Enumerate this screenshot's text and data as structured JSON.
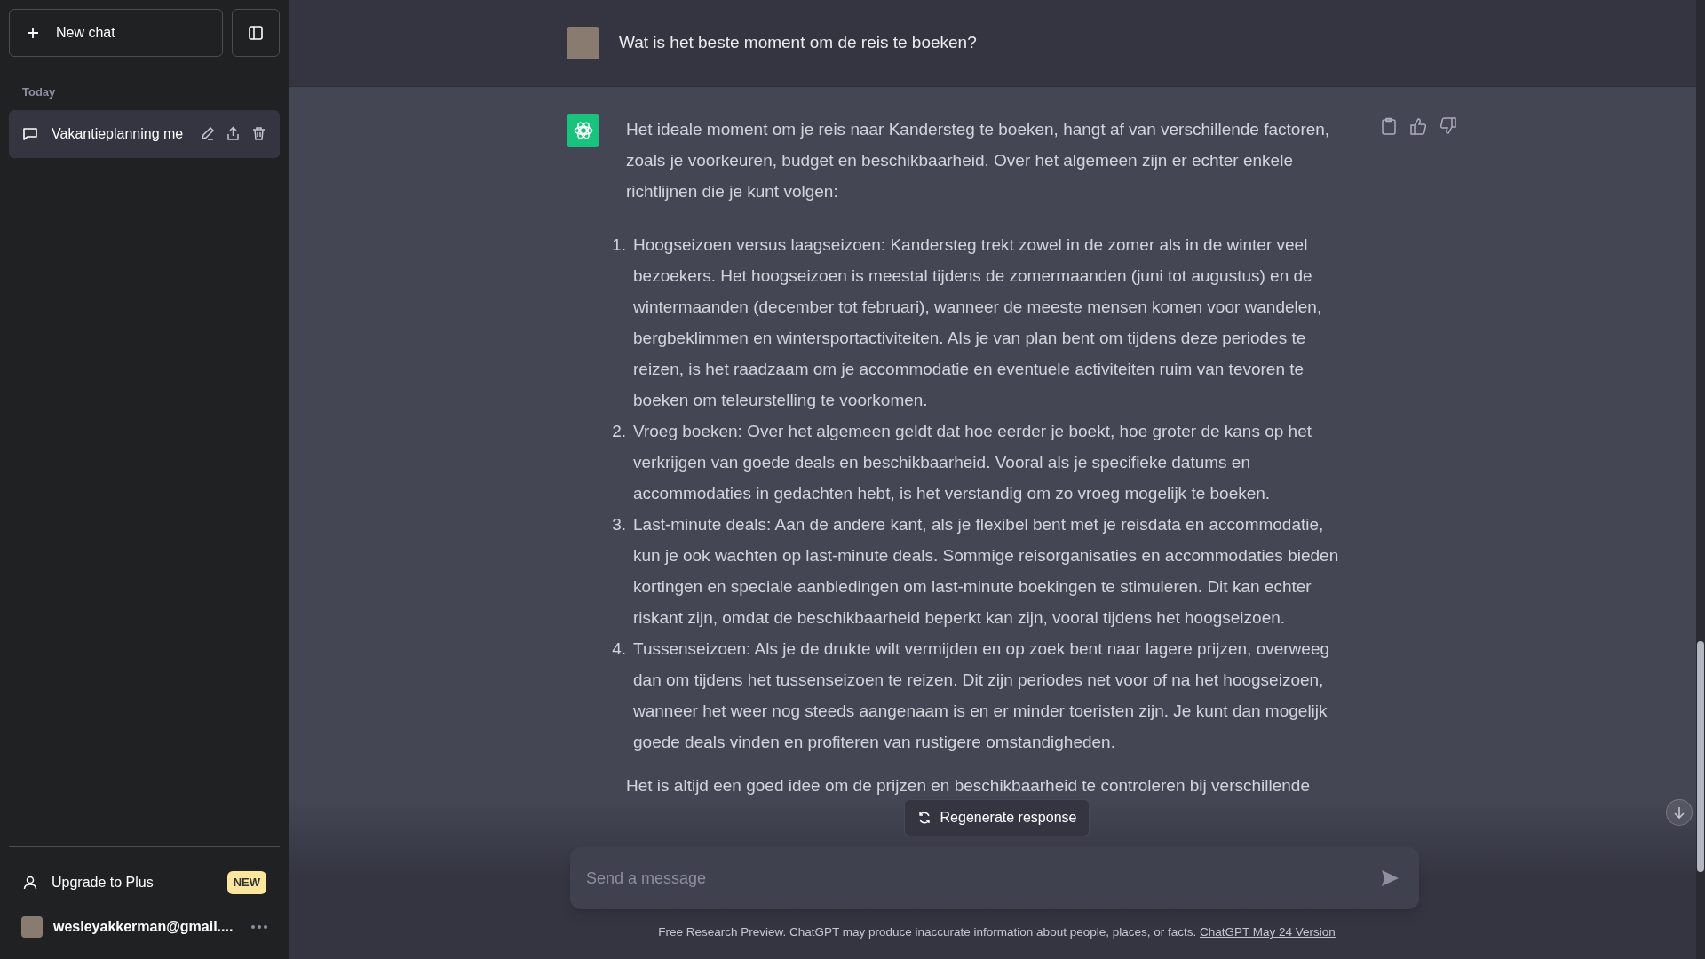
{
  "sidebar": {
    "new_chat": "New chat",
    "section_label": "Today",
    "conversations": [
      {
        "title": "Vakantieplanning me",
        "selected": true
      }
    ],
    "upgrade": {
      "label": "Upgrade to Plus",
      "badge": "NEW"
    },
    "account": {
      "email": "wesleyakkerman@gmail...."
    }
  },
  "messages": [
    {
      "kind": "user",
      "text": "Wat is het beste moment om de reis te boeken?"
    },
    {
      "kind": "assistant",
      "intro": "Het ideale moment om je reis naar Kandersteg te boeken, hangt af van verschillende factoren, zoals je voorkeuren, budget en beschikbaarheid. Over het algemeen zijn er echter enkele richtlijnen die je kunt volgen:",
      "list": [
        {
          "number": "1.",
          "text": "Hoogseizoen versus laagseizoen: Kandersteg trekt zowel in de zomer als in de winter veel bezoekers. Het hoogseizoen is meestal tijdens de zomermaanden (juni tot augustus) en de wintermaanden (december tot februari), wanneer de meeste mensen komen voor wandelen, bergbeklimmen en wintersportactiviteiten. Als je van plan bent om tijdens deze periodes te reizen, is het raadzaam om je accommodatie en eventuele activiteiten ruim van tevoren te boeken om teleurstelling te voorkomen."
        },
        {
          "number": "2.",
          "text": "Vroeg boeken: Over het algemeen geldt dat hoe eerder je boekt, hoe groter de kans op het verkrijgen van goede deals en beschikbaarheid. Vooral als je specifieke datums en accommodaties in gedachten hebt, is het verstandig om zo vroeg mogelijk te boeken."
        },
        {
          "number": "3.",
          "text": "Last-minute deals: Aan de andere kant, als je flexibel bent met je reisdata en accommodatie, kun je ook wachten op last-minute deals. Sommige reisorganisaties en accommodaties bieden kortingen en speciale aanbiedingen om last-minute boekingen te stimuleren. Dit kan echter riskant zijn, omdat de beschikbaarheid beperkt kan zijn, vooral tijdens het hoogseizoen."
        },
        {
          "number": "4.",
          "text": "Tussenseizoen: Als je de drukte wilt vermijden en op zoek bent naar lagere prijzen, overweeg dan om tijdens het tussenseizoen te reizen. Dit zijn periodes net voor of na het hoogseizoen, wanneer het weer nog steeds aangenaam is en er minder toeristen zijn. Je kunt dan mogelijk goede deals vinden en profiteren van rustigere omstandigheden."
        }
      ],
      "outro": "Het is altijd een goed idee om de prijzen en beschikbaarheid te controleren bij verschillende"
    }
  ],
  "regenerate": "Regenerate response",
  "composer": {
    "placeholder": "Send a message"
  },
  "footer": {
    "text": "Free Research Preview. ChatGPT may produce inaccurate information about people, places, or facts.",
    "link": "ChatGPT May 24 Version"
  }
}
